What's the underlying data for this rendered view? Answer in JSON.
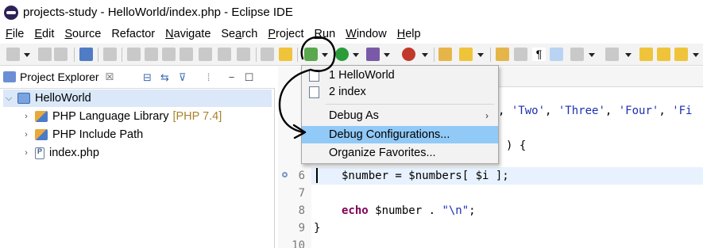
{
  "window": {
    "title": "projects-study - HelloWorld/index.php - Eclipse IDE"
  },
  "menu": {
    "items": [
      {
        "first": "F",
        "rest": "ile"
      },
      {
        "first": "E",
        "rest": "dit"
      },
      {
        "first": "S",
        "rest": "ource"
      },
      {
        "first": "",
        "rest": "Refactor"
      },
      {
        "first": "N",
        "rest": "avigate"
      },
      {
        "first": "",
        "rest": "Search",
        "pre": "Se",
        "u": "a",
        "post": "rch"
      },
      {
        "first": "P",
        "rest": "roject"
      },
      {
        "first": "R",
        "rest": "un"
      },
      {
        "first": "W",
        "rest": "indow"
      },
      {
        "first": "H",
        "rest": "elp"
      }
    ]
  },
  "explorer": {
    "tab_label": "Project Explorer",
    "close_glyph": "☒",
    "tree": [
      {
        "label": "HelloWorld",
        "note": ""
      },
      {
        "label": "PHP Language Library",
        "note": "[PHP 7.4]"
      },
      {
        "label": "PHP Include Path",
        "note": ""
      },
      {
        "label": "index.php",
        "note": ""
      }
    ]
  },
  "editor": {
    "lines": [
      {
        "num": "6",
        "text": "$number = $numbers[ $i ];"
      },
      {
        "num": "7",
        "text": ""
      },
      {
        "num": "8",
        "kw": "echo",
        "rest": " $number . ",
        "str": "\"\\n\"",
        "tail": ";"
      },
      {
        "num": "9",
        "text": "}"
      },
      {
        "num": "10",
        "text": ""
      }
    ],
    "line3_fragment_strings": [
      "'Two'",
      "'Three'",
      "'Four'",
      "'Fi"
    ],
    "line4_fragment": ") {"
  },
  "debug_menu": {
    "items": [
      {
        "label": "1 HelloWorld"
      },
      {
        "label": "2 index"
      },
      {
        "label": "Debug As"
      },
      {
        "label": "Debug Configurations..."
      },
      {
        "label": "Organize Favorites..."
      }
    ],
    "highlighted_index": 3,
    "submenu_arrow": "›"
  },
  "colors": {
    "highlight": "#91c9f7",
    "selection": "#dbe8f9",
    "keyword": "#7f0055",
    "string": "#1b2fb0",
    "library_note": "#a9822b"
  }
}
